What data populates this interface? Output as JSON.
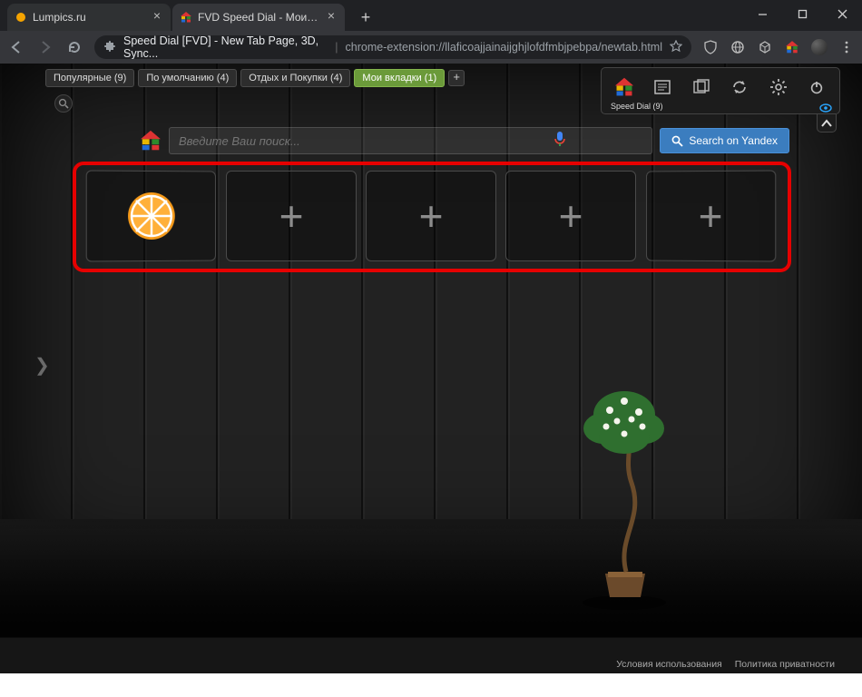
{
  "window": {
    "tabs": [
      {
        "label": "Lumpics.ru"
      },
      {
        "label": "FVD Speed Dial - Мои вкладки"
      }
    ]
  },
  "address_bar": {
    "ext_name": "Speed Dial [FVD] - New Tab Page, 3D, Sync...",
    "url": "chrome-extension://llaficoajjainaijghjlofdfmbjpebpa/newtab.html"
  },
  "group_tabs": {
    "items": [
      {
        "label": "Популярные (9)"
      },
      {
        "label": "По умолчанию (4)"
      },
      {
        "label": "Отдых и Покупки (4)"
      },
      {
        "label": "Мои вкладки (1)"
      }
    ]
  },
  "panel": {
    "caption": "Speed Dial (9)"
  },
  "search": {
    "placeholder": "Введите Ваш поиск...",
    "button": "Search on Yandex"
  },
  "footer": {
    "terms": "Условия использования",
    "privacy": "Политика приватности"
  }
}
